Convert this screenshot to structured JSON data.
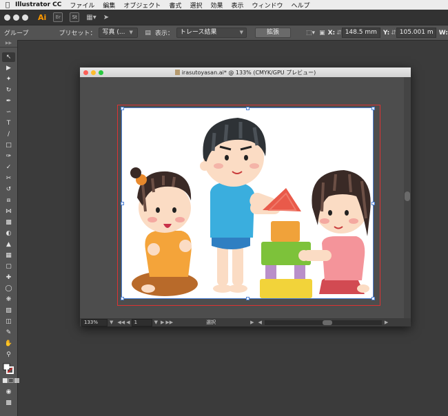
{
  "menubar": {
    "app": "Illustrator CC",
    "items": [
      "ファイル",
      "編集",
      "オブジェクト",
      "書式",
      "選択",
      "効果",
      "表示",
      "ウィンドウ",
      "ヘルプ"
    ]
  },
  "appbar": {
    "logo": "Ai",
    "br_label": "Br",
    "st_label": "St"
  },
  "control": {
    "selection_type": "グループ",
    "preset_label": "プリセット：",
    "preset_value": "写真 (...",
    "view_label": "表示：",
    "view_value": "トレース結果",
    "expand_button": "拡張",
    "x_label": "X:",
    "x_value": "148.5 mm",
    "y_label": "Y:",
    "y_value": "105.001 m",
    "w_label": "W:"
  },
  "document": {
    "title": "irasutoyasan.ai* @ 133% (CMYK/GPU プレビュー)",
    "zoom": "133%",
    "page": "1",
    "status_tool": "選択"
  },
  "colors": {
    "artboard_border": "#dd3333",
    "selection_blue": "#4a7fd4",
    "ai_orange": "#ff9a00"
  }
}
